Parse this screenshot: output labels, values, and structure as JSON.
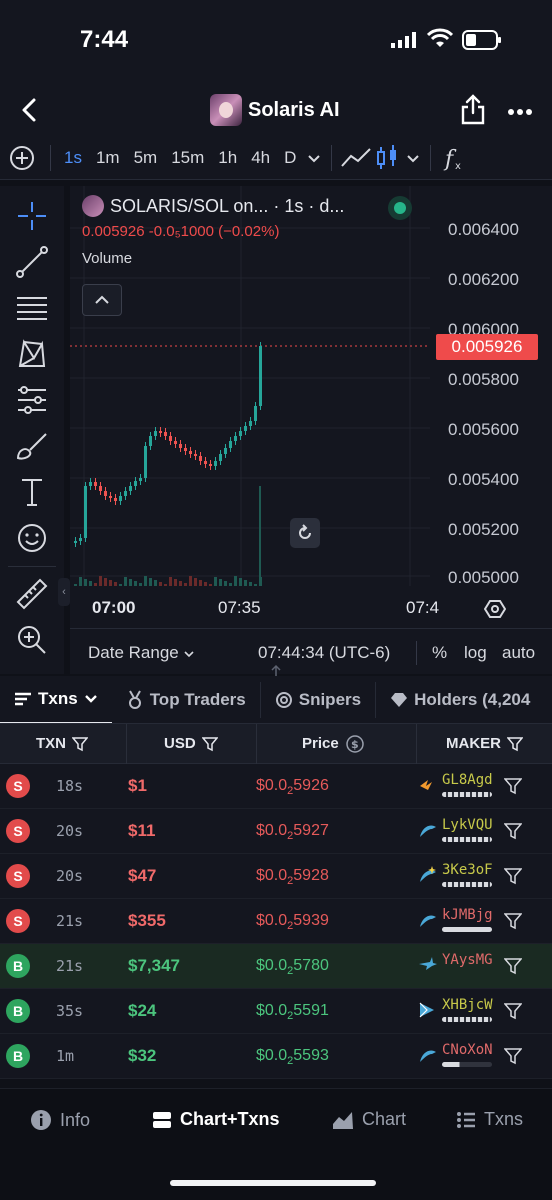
{
  "status": {
    "time": "7:44"
  },
  "nav": {
    "title": "Solaris AI"
  },
  "toolbar": {
    "intervals": [
      "1s",
      "1m",
      "5m",
      "15m",
      "1h",
      "4h",
      "D"
    ],
    "active_interval": "1s"
  },
  "chart": {
    "legend_title": "SOLARIS/SOL on... · 1s · d...",
    "legend_price": "0.005926 -0.0₅1000 (−0.02%)",
    "volume_label": "Volume",
    "current_price_tag": "0.005926",
    "x_labels": [
      "07:00",
      "07:35",
      "07:4"
    ],
    "y_labels": [
      "0.006400",
      "0.006200",
      "0.006000",
      "0.005800",
      "0.005600",
      "0.005400",
      "0.005200",
      "0.005000"
    ]
  },
  "chart_footer": {
    "date_range": "Date Range",
    "time": "07:44:34 (UTC-6)",
    "pct": "%",
    "log": "log",
    "auto": "auto"
  },
  "tabs": {
    "txns": "Txns",
    "top_traders": "Top Traders",
    "snipers": "Snipers",
    "holders": "Holders (4,204"
  },
  "table": {
    "headers": {
      "txn": "TXN",
      "usd": "USD",
      "price": "Price",
      "maker": "MAKER"
    },
    "rows": [
      {
        "type": "S",
        "age": "18s",
        "usd": "$1",
        "price_pre": "$0.0",
        "price_sub": "2",
        "price_post": "5926",
        "maker": "GL8Agd",
        "maker_color": "#c7c94a"
      },
      {
        "type": "S",
        "age": "20s",
        "usd": "$11",
        "price_pre": "$0.0",
        "price_sub": "2",
        "price_post": "5927",
        "maker": "LykVQU",
        "maker_color": "#c7c94a"
      },
      {
        "type": "S",
        "age": "20s",
        "usd": "$47",
        "price_pre": "$0.0",
        "price_sub": "2",
        "price_post": "5928",
        "maker": "3Ke3oF",
        "maker_color": "#c7c94a"
      },
      {
        "type": "S",
        "age": "21s",
        "usd": "$355",
        "price_pre": "$0.0",
        "price_sub": "2",
        "price_post": "5939",
        "maker": "kJMBjg",
        "maker_color": "#e06a6a"
      },
      {
        "type": "B",
        "age": "21s",
        "usd": "$7,347",
        "price_pre": "$0.0",
        "price_sub": "2",
        "price_post": "5780",
        "maker": "YAysMG",
        "maker_color": "#e06a6a"
      },
      {
        "type": "B",
        "age": "35s",
        "usd": "$24",
        "price_pre": "$0.0",
        "price_sub": "2",
        "price_post": "5591",
        "maker": "XHBjcW",
        "maker_color": "#c7c94a"
      },
      {
        "type": "B",
        "age": "1m",
        "usd": "$32",
        "price_pre": "$0.0",
        "price_sub": "2",
        "price_post": "5593",
        "maker": "CNoXoN",
        "maker_color": "#e06a6a"
      }
    ]
  },
  "bottom_nav": {
    "info": "Info",
    "chart_txns": "Chart+Txns",
    "chart": "Chart",
    "txns": "Txns"
  },
  "colors": {
    "sell": "#e24b4b",
    "buy": "#2ea55f",
    "accent": "#4d8ef7"
  }
}
